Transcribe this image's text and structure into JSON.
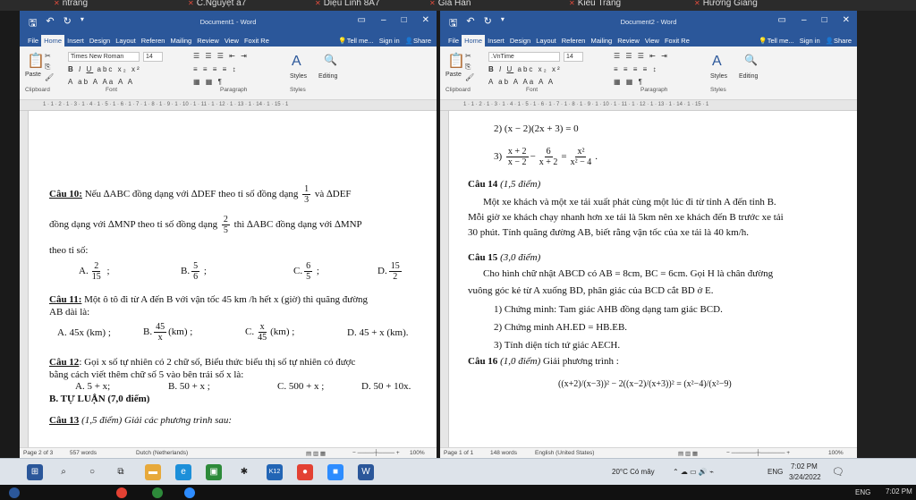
{
  "participants": [
    "ntrang",
    "C.Nguyệt a7",
    "Diệu Linh 8A7",
    "Gia Hân",
    "Kiều Trang",
    "Hương Giang"
  ],
  "left_window": {
    "title": "Document1 - Word",
    "tabs": [
      "File",
      "Home",
      "Insert",
      "Design",
      "Layout",
      "Referen",
      "Mailing",
      "Review",
      "View",
      "Foxit Re"
    ],
    "active_tab": "Home",
    "tell_me": "Tell me...",
    "sign_in": "Sign in",
    "share": "Share",
    "font_name": "Times New Roman",
    "font_size": "14",
    "groups": {
      "clipboard": "Clipboard",
      "font": "Font",
      "paragraph": "Paragraph",
      "styles": "Styles"
    },
    "paste": "Paste",
    "styles_btn": "Styles",
    "editing_btn": "Editing",
    "ruler": "1 · 1 · 2 · 1 · 3 · 1 · 4 · 1 · 5 · 1 · 6 · 1 · 7 · 1 · 8 · 1 · 9 · 1 · 10 · 1 · 11 · 1 · 12 · 1 · 13 · 1 · 14 · 1 · 15 · 1",
    "status": {
      "page": "Page 2 of 3",
      "words": "557 words",
      "lang": "Dutch (Netherlands)",
      "zoom": "100%"
    },
    "doc": {
      "q10_label": "Câu 10:",
      "q10_text": " Nếu ∆ABC đồng dạng với ∆DEF theo tỉ số đồng dạng",
      "q10_frac": [
        "1",
        "3"
      ],
      "q10_tail": " và ∆DEF",
      "q10_line2": "đồng dạng với ∆MNP  theo tỉ số đồng dạng",
      "q10_frac2": [
        "2",
        "5"
      ],
      "q10_line2_tail": " thì ∆ABC đồng dạng với ∆MNP",
      "q10_line3": "theo tỉ số:",
      "q10_a": "A.",
      "q10_a_frac": [
        "2",
        "15"
      ],
      "q10_b": "B.",
      "q10_b_frac": [
        "5",
        "6"
      ],
      "q10_c": "C.",
      "q10_c_frac": [
        "6",
        "5"
      ],
      "q10_d": "D.",
      "q10_d_frac": [
        "15",
        "2"
      ],
      "q11_label": "Câu 11:",
      "q11_text": " Một ô tô đi từ A đến B với vận tốc 45 km /h hết x (giờ) thì quãng đường",
      "q11_line2": "AB dài là:",
      "q11_a": "A. 45x (km) ;",
      "q11_b": "B.",
      "q11_b_frac": [
        "45",
        "x"
      ],
      "q11_b_tail": "(km)    ;",
      "q11_c": "C.",
      "q11_c_frac": [
        "x",
        "45"
      ],
      "q11_c_tail": "(km)    ;",
      "q11_d": "D. 45 + x (km).",
      "q12_label": "Câu 12",
      "q12_text": ": Gọi x số tự nhiên có 2 chữ số, Biểu thức biểu thị số tự nhiên có được",
      "q12_line2": "bằng cách viết thêm chữ số 5 vào bên trái số x là:",
      "q12_a": "A. 5 + x;",
      "q12_b": "B. 50 + x ;",
      "q12_c": "C. 500 + x ;",
      "q12_d": "D. 50 + 10x.",
      "partB": "B. TỰ LUẬN (7,0 điểm)",
      "q13_label": "Câu 13",
      "q13_text": " (1,5 điểm) Giải các phương trình sau:"
    }
  },
  "right_window": {
    "title": "Document2 - Word",
    "tabs": [
      "File",
      "Home",
      "Insert",
      "Design",
      "Layout",
      "Referen",
      "Mailing",
      "Review",
      "View",
      "Foxit Re"
    ],
    "active_tab": "Home",
    "tell_me": "Tell me...",
    "sign_in": "Sign in",
    "share": "Share",
    "font_name": ".VnTime",
    "font_size": "14",
    "groups": {
      "clipboard": "Clipboard",
      "font": "Font",
      "paragraph": "Paragraph",
      "styles": "Styles"
    },
    "paste": "Paste",
    "styles_btn": "Styles",
    "editing_btn": "Editing",
    "ruler": "1 · 1 · 2 · 1 · 3 · 1 · 4 · 1 · 5 · 1 · 6 · 1 · 7 · 1 · 8 · 1 · 9 · 1 · 10 · 1 · 11 · 1 · 12 · 1 · 13 · 1 · 14 · 1 · 15 · 1",
    "status": {
      "page": "Page 1 of 1",
      "words": "148 words",
      "lang": "English (United States)",
      "zoom": "100%"
    },
    "doc": {
      "eq2": "2)  (x − 2)(2x + 3) = 0",
      "eq3_label": "3)",
      "eq3_f1": [
        "x + 2",
        "x − 2"
      ],
      "eq3_f2": [
        "6",
        "x + 2"
      ],
      "eq3_f3": [
        "x²",
        "x² − 4"
      ],
      "q14_label": "Câu 14",
      "q14_pts": " (1,5 điểm)",
      "q14_l1": "Một xe khách và một xe tải xuất phát cùng một lúc đi từ tỉnh A đến tỉnh B.",
      "q14_l2": "Mỗi giờ xe khách chạy nhanh hơn xe tải là 5km nên xe khách đến B trước xe tải",
      "q14_l3": "30 phút. Tính quãng đường AB, biết rằng vận tốc của xe tải là 40 km/h.",
      "q15_label": "Câu 15",
      "q15_pts": " (3,0 điểm)",
      "q15_l1": "Cho hình chữ nhật ABCD có AB = 8cm, BC = 6cm. Gọi H là chân đường",
      "q15_l2": "vuông góc kẻ từ A xuống BD, phân giác của BCD cắt BD ở E.",
      "q15_1": "1) Chứng minh: Tam giác AHB đồng dạng tam giác BCD.",
      "q15_2": "2) Chứng minh AH.ED = HB.EB.",
      "q15_3": "3) Tính diện tích tứ giác AECH.",
      "q16_label": "Câu 16",
      "q16_pts": " (1,0 điểm)",
      "q16_text": " Giải phương trình :",
      "q16_eq": "((x+2)/(x−3))² − 2((x−2)/(x+3))² = (x²−4)/(x²−9)"
    }
  },
  "taskbar": {
    "weather": "20°C Có mây",
    "lang": "ENG",
    "time": "7:02 PM",
    "date": "3/24/2022"
  },
  "zoom_bar": {
    "lang": "ENG",
    "time": "7:02 PM"
  }
}
